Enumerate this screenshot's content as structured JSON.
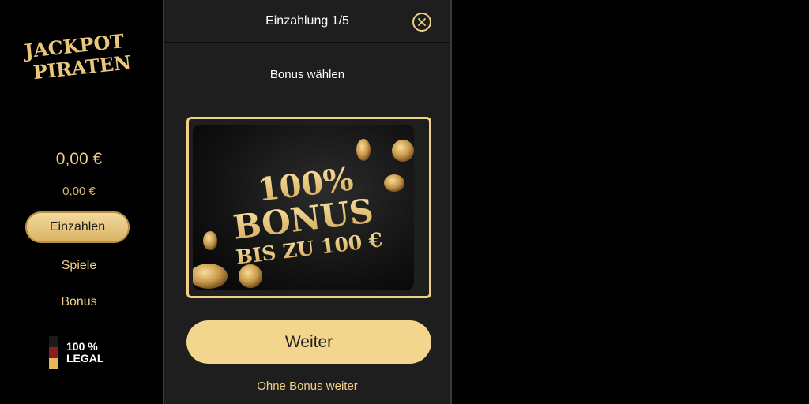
{
  "brand": {
    "logo_line1": "JACKPOT",
    "logo_line2": "PIRATEN"
  },
  "sidebar": {
    "balance_main": "0,00 €",
    "balance_sub": "0,00 €",
    "deposit_label": "Einzahlen",
    "nav": [
      {
        "label": "Spiele"
      },
      {
        "label": "Bonus"
      }
    ],
    "legal": {
      "line1": "100 %",
      "line2": "LEGAL"
    }
  },
  "modal": {
    "title": "Einzahlung 1/5",
    "subtitle": "Bonus wählen",
    "bonus": {
      "line1": "100%",
      "line2": "BONUS",
      "line3": "BIS ZU 100 €"
    },
    "next_label": "Weiter",
    "skip_label": "Ohne Bonus weiter"
  },
  "colors": {
    "gold": "#f0cf86",
    "button_gold": "#f3d68d",
    "modal_bg": "#1e1e1e",
    "page_bg": "#000000"
  }
}
